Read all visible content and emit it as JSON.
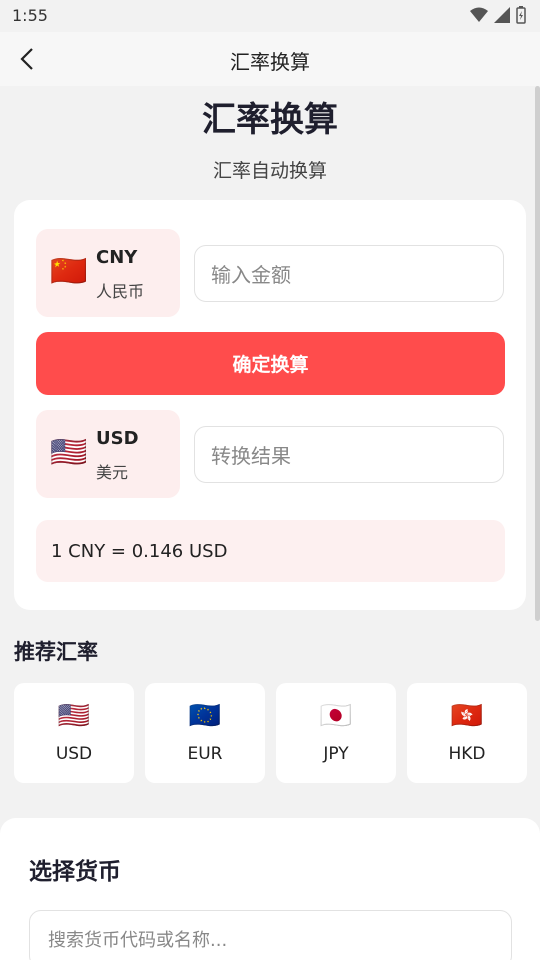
{
  "status": {
    "time": "1:55"
  },
  "app_bar": {
    "title": "汇率换算"
  },
  "hero": {
    "title": "汇率换算",
    "subtitle": "汇率自动换算"
  },
  "converter": {
    "from": {
      "flag": "🇨🇳",
      "code": "CNY",
      "name": "人民币",
      "placeholder": "输入金额"
    },
    "button_label": "确定换算",
    "to": {
      "flag": "🇺🇸",
      "code": "USD",
      "name": "美元",
      "placeholder": "转换结果"
    },
    "rate_text": "1 CNY = 0.146 USD"
  },
  "recommended": {
    "title": "推荐汇率",
    "items": [
      {
        "flag": "🇺🇸",
        "code": "USD"
      },
      {
        "flag": "🇪🇺",
        "code": "EUR"
      },
      {
        "flag": "🇯🇵",
        "code": "JPY"
      },
      {
        "flag": "🇭🇰",
        "code": "HKD"
      }
    ]
  },
  "sheet": {
    "title": "选择货币",
    "search_placeholder": "搜索货币代码或名称..."
  },
  "colors": {
    "accent": "#ff4c4c",
    "accent_light": "#fdeeee"
  }
}
